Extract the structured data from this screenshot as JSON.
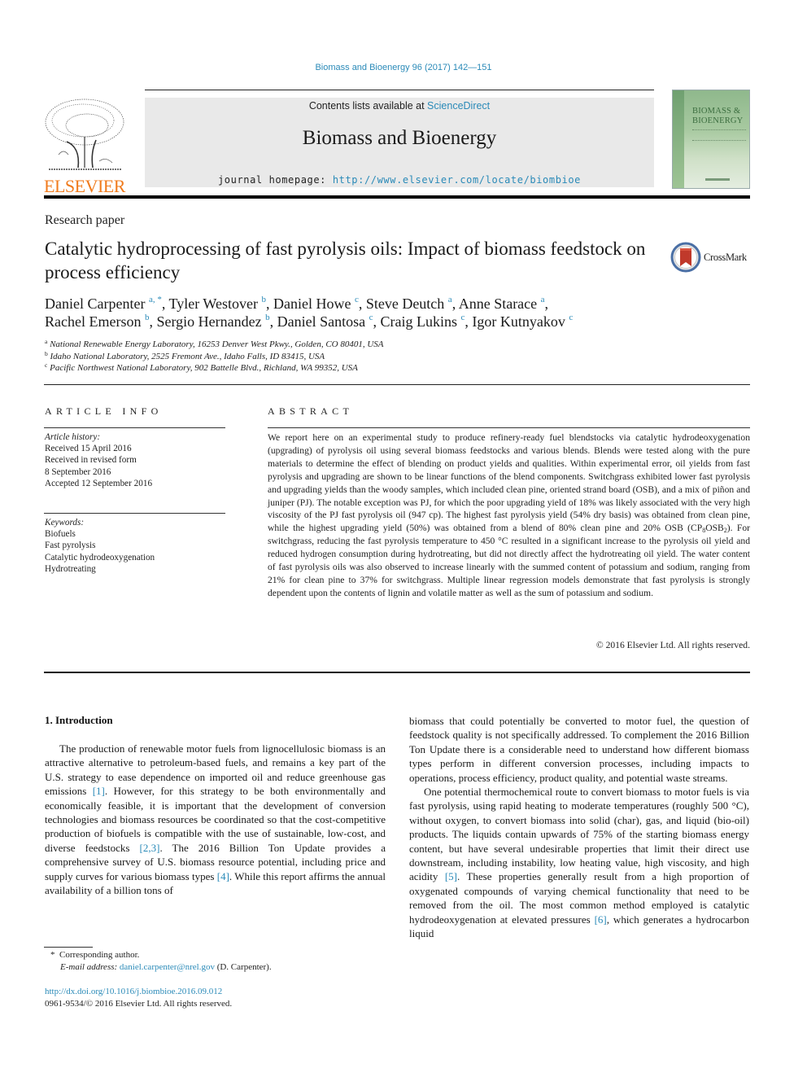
{
  "header": {
    "citation": "Biomass and Bioenergy 96 (2017) 142—151",
    "contents_prefix": "Contents lists available at ",
    "contents_link": "ScienceDirect",
    "journal_title": "Biomass and Bioenergy",
    "homepage_prefix": "journal homepage: ",
    "homepage_url": "http://www.elsevier.com/locate/biombioe",
    "publisher_wordmark": "ELSEVIER",
    "cover_title_line1": "BIOMASS &",
    "cover_title_line2": "BIOENERGY",
    "crossmark_label": "CrossMark"
  },
  "article": {
    "type": "Research paper",
    "title": "Catalytic hydroprocessing of fast pyrolysis oils: Impact of biomass feedstock on process efficiency",
    "authors": [
      {
        "name": "Daniel Carpenter",
        "aff": "a, *"
      },
      {
        "name": "Tyler Westover",
        "aff": "b"
      },
      {
        "name": "Daniel Howe",
        "aff": "c"
      },
      {
        "name": "Steve Deutch",
        "aff": "a"
      },
      {
        "name": "Anne Starace",
        "aff": "a"
      },
      {
        "name": "Rachel Emerson",
        "aff": "b"
      },
      {
        "name": "Sergio Hernandez",
        "aff": "b"
      },
      {
        "name": "Daniel Santosa",
        "aff": "c"
      },
      {
        "name": "Craig Lukins",
        "aff": "c"
      },
      {
        "name": "Igor Kutnyakov",
        "aff": "c"
      }
    ],
    "affiliations": [
      {
        "key": "a",
        "text": "National Renewable Energy Laboratory, 16253 Denver West Pkwy., Golden, CO 80401, USA"
      },
      {
        "key": "b",
        "text": "Idaho National Laboratory, 2525 Fremont Ave., Idaho Falls, ID 83415, USA"
      },
      {
        "key": "c",
        "text": "Pacific Northwest National Laboratory, 902 Battelle Blvd., Richland, WA 99352, USA"
      }
    ]
  },
  "article_info": {
    "heading": "ARTICLE INFO",
    "history_label": "Article history:",
    "history": [
      "Received 15 April 2016",
      "Received in revised form",
      "8 September 2016",
      "Accepted 12 September 2016"
    ],
    "keywords_label": "Keywords:",
    "keywords": [
      "Biofuels",
      "Fast pyrolysis",
      "Catalytic hydrodeoxygenation",
      "Hydrotreating"
    ]
  },
  "abstract": {
    "heading": "ABSTRACT",
    "text_part1": "We report here on an experimental study to produce refinery-ready fuel blendstocks via catalytic hydrodeoxygenation (upgrading) of pyrolysis oil using several biomass feedstocks and various blends. Blends were tested along with the pure materials to determine the effect of blending on product yields and qualities. Within experimental error, oil yields from fast pyrolysis and upgrading are shown to be linear functions of the blend components. Switchgrass exhibited lower fast pyrolysis and upgrading yields than the woody samples, which included clean pine, oriented strand board (OSB), and a mix of piñon and juniper (PJ). The notable exception was PJ, for which the poor upgrading yield of 18% was likely associated with the very high viscosity of the PJ fast pyrolysis oil (947 cp). The highest fast pyrolysis yield (54% dry basis) was obtained from clean pine, while the highest upgrading yield (50%) was obtained from a blend of 80% clean pine and 20% OSB (CP",
    "sub1": "8",
    "text_part2": "OSB",
    "sub2": "2",
    "text_part3": "). For switchgrass, reducing the fast pyrolysis temperature to 450 °C resulted in a significant increase to the pyrolysis oil yield and reduced hydrogen consumption during hydrotreating, but did not directly affect the hydrotreating oil yield. The water content of fast pyrolysis oils was also observed to increase linearly with the summed content of potassium and sodium, ranging from 21% for clean pine to 37% for switchgrass. Multiple linear regression models demonstrate that fast pyrolysis is strongly dependent upon the contents of lignin and volatile matter as well as the sum of potassium and sodium.",
    "copyright": "© 2016 Elsevier Ltd. All rights reserved."
  },
  "body": {
    "section_heading": "1.  Introduction",
    "left_p1_a": "The production of renewable motor fuels from lignocellulosic biomass is an attractive alternative to petroleum-based fuels, and remains a key part of the U.S. strategy to ease dependence on imported oil and reduce greenhouse gas emissions ",
    "left_ref1": "[1]",
    "left_p1_b": ". However, for this strategy to be both environmentally and economically feasible, it is important that the development of conversion technologies and biomass resources be coordinated so that the cost-competitive production of biofuels is compatible with the use of sustainable, low-cost, and diverse feedstocks ",
    "left_ref2": "[2,3]",
    "left_p1_c": ". The 2016 Billion Ton Update provides a comprehensive survey of U.S. biomass resource potential, including price and supply curves for various biomass types ",
    "left_ref3": "[4]",
    "left_p1_d": ". While this report affirms the annual availability of a billion tons of",
    "right_p1": "biomass that could potentially be converted to motor fuel, the question of feedstock quality is not specifically addressed. To complement the 2016 Billion Ton Update there is a considerable need to understand how different biomass types perform in different conversion processes, including impacts to operations, process efficiency, product quality, and potential waste streams.",
    "right_p2_a": "One potential thermochemical route to convert biomass to motor fuels is via fast pyrolysis, using rapid heating to moderate temperatures (roughly 500 °C), without oxygen, to convert biomass into solid (char), gas, and liquid (bio-oil) products. The liquids contain upwards of 75% of the starting biomass energy content, but have several undesirable properties that limit their direct use downstream, including instability, low heating value, high viscosity, and high acidity ",
    "right_ref5": "[5]",
    "right_p2_b": ". These properties generally result from a high proportion of oxygenated compounds of varying chemical functionality that need to be removed from the oil. The most common method employed is catalytic hydrodeoxygenation at elevated pressures ",
    "right_ref6": "[6]",
    "right_p2_c": ", which generates a hydrocarbon liquid"
  },
  "footnotes": {
    "corresponding_marker": "*",
    "corresponding_text": "Corresponding author.",
    "email_label": "E-mail address:",
    "email": "daniel.carpenter@nrel.gov",
    "email_suffix": " (D. Carpenter).",
    "doi": "http://dx.doi.org/10.1016/j.biombioe.2016.09.012",
    "issn_copyright": "0961-9534/© 2016 Elsevier Ltd. All rights reserved."
  },
  "colors": {
    "link": "#2a8ab8",
    "elsevier_orange": "#f07b1d",
    "masthead_grey": "#e9e9e9"
  }
}
